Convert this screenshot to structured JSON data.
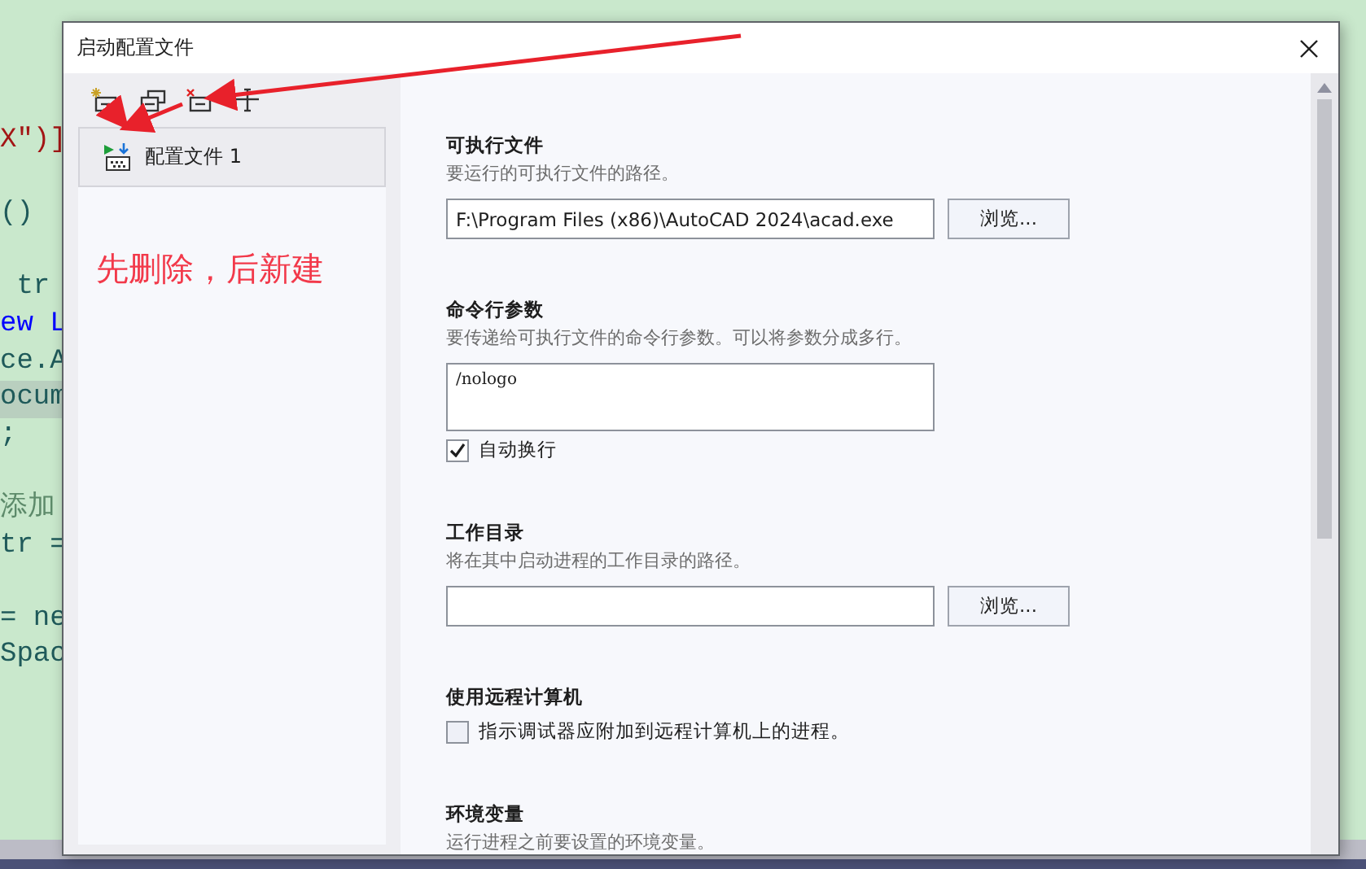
{
  "editor": {
    "lines": [
      {
        "kind": "string",
        "text": "X\")]"
      },
      {
        "kind": "blank"
      },
      {
        "kind": "plain",
        "text": "()"
      },
      {
        "kind": "blank"
      },
      {
        "kind": "plain",
        "text": " tr"
      },
      {
        "kind": "keyword",
        "text": "ew L"
      },
      {
        "kind": "plain",
        "text": "ce.A"
      },
      {
        "kind": "plain",
        "text": "ocum",
        "selected": true
      },
      {
        "kind": "plain",
        "text": ";"
      },
      {
        "kind": "blank"
      },
      {
        "kind": "comment",
        "text": "添加"
      },
      {
        "kind": "plain",
        "text": "tr ="
      },
      {
        "kind": "blank"
      },
      {
        "kind": "plain",
        "text": "= ne"
      },
      {
        "kind": "plain",
        "text": "Spac"
      }
    ]
  },
  "window": {
    "title": "启动配置文件"
  },
  "sidebar": {
    "tools": [
      {
        "kind": "new"
      },
      {
        "kind": "copy"
      },
      {
        "kind": "delete"
      },
      {
        "kind": "rename"
      }
    ],
    "items": [
      {
        "label": "配置文件 1",
        "selected": true
      }
    ],
    "note": "先删除，后新建"
  },
  "sections": [
    {
      "kind": "path",
      "title": "可执行文件",
      "description": "要运行的可执行文件的路径。",
      "value": "F:\\Program Files (x86)\\AutoCAD 2024\\acad.exe",
      "button": "浏览..."
    },
    {
      "kind": "textarea",
      "title": "命令行参数",
      "description": "要传递给可执行文件的命令行参数。可以将参数分成多行。",
      "value": "/nologo",
      "checkbox": {
        "label": "自动换行",
        "checked": true
      }
    },
    {
      "kind": "path",
      "title": "工作目录",
      "description": "将在其中启动进程的工作目录的路径。",
      "button": "浏览..."
    },
    {
      "kind": "checkbox",
      "title": "使用远程计算机",
      "checkbox": {
        "label": "指示调试器应附加到远程计算机上的进程。",
        "checked": false
      }
    },
    {
      "kind": "header",
      "title": "环境变量",
      "description": "运行进程之前要设置的环境变量。"
    }
  ]
}
